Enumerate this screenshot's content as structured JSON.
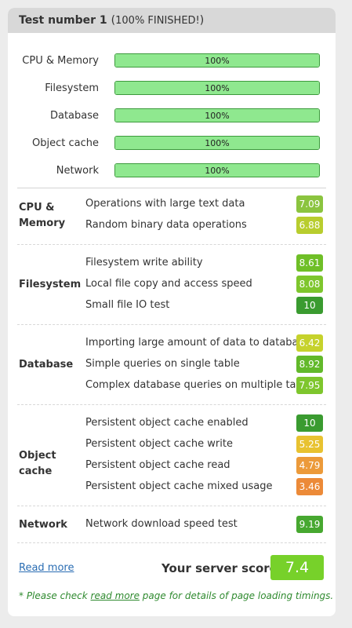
{
  "header": {
    "title": "Test number 1",
    "paren_open": "(",
    "status": "100% FINISHED!",
    "paren_close": ")"
  },
  "progress": [
    {
      "label": "CPU & Memory",
      "percent_text": "100%",
      "fill": 1.0
    },
    {
      "label": "Filesystem",
      "percent_text": "100%",
      "fill": 1.0
    },
    {
      "label": "Database",
      "percent_text": "100%",
      "fill": 1.0
    },
    {
      "label": "Object cache",
      "percent_text": "100%",
      "fill": 1.0
    },
    {
      "label": "Network",
      "percent_text": "100%",
      "fill": 1.0
    }
  ],
  "categories": {
    "cpu": {
      "label_line1": "CPU &",
      "label_line2": "Memory",
      "tests": [
        {
          "name": "Operations with large text data",
          "score": "7.09",
          "color": "#8bc43f"
        },
        {
          "name": "Random binary data operations",
          "score": "6.88",
          "color": "#b8cd2e"
        }
      ]
    },
    "filesystem": {
      "label": "Filesystem",
      "tests": [
        {
          "name": "Filesystem write ability",
          "score": "8.61",
          "color": "#6fbf27"
        },
        {
          "name": "Local file copy and access speed",
          "score": "8.08",
          "color": "#7ec62d"
        },
        {
          "name": "Small file IO test",
          "score": "10",
          "color": "#3a9b30"
        }
      ]
    },
    "database": {
      "label": "Database",
      "tests": [
        {
          "name": "Importing large amount of data to database",
          "score": "6.42",
          "color": "#c6d22c"
        },
        {
          "name": "Simple queries on single table",
          "score": "8.92",
          "color": "#62b92a"
        },
        {
          "name": "Complex database queries on multiple tables",
          "score": "7.95",
          "color": "#7ec62d"
        }
      ]
    },
    "objectcache": {
      "label": "Object cache",
      "tests": [
        {
          "name": "Persistent object cache enabled",
          "score": "10",
          "color": "#3a9b30"
        },
        {
          "name": "Persistent object cache write",
          "score": "5.25",
          "color": "#e8c230"
        },
        {
          "name": "Persistent object cache read",
          "score": "4.79",
          "color": "#ec9a3a"
        },
        {
          "name": "Persistent object cache mixed usage",
          "score": "3.46",
          "color": "#ec8a38"
        }
      ]
    },
    "network": {
      "label": "Network",
      "tests": [
        {
          "name": "Network download speed test",
          "score": "9.19",
          "color": "#47a830"
        }
      ]
    }
  },
  "footer": {
    "read_more": "Read more",
    "server_score_label": "Your server score",
    "server_score": "7.4",
    "server_score_color": "#77d12a",
    "note_prefix": "* Please check ",
    "note_link": "read more",
    "note_suffix": " page for details of page loading timings."
  }
}
